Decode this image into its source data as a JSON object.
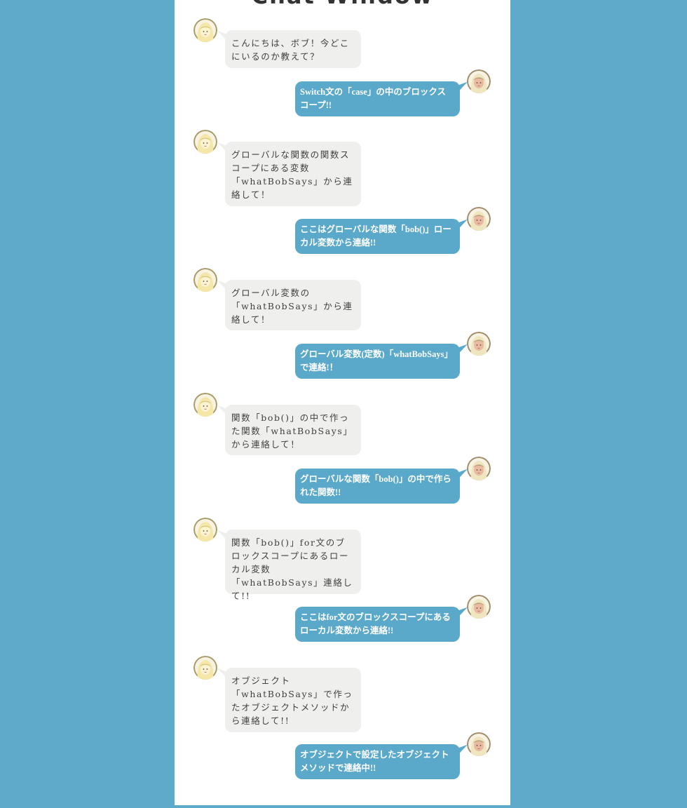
{
  "window": {
    "title": "Chat Window"
  },
  "colors": {
    "page_background": "#5eaacb",
    "left_bubble": "#eff0ee",
    "right_bubble": "#5aa9ca",
    "left_avatar_hair": "#f4e7a8",
    "right_avatar_hair": "#efe5bf"
  },
  "icons": {
    "alice_avatar": "blonde-girl-avatar-icon",
    "bob_avatar": "pink-girl-avatar-icon"
  },
  "messages": [
    {
      "side": "left",
      "text": "こんにちは、ボブ！今どこにいるのか教えて？"
    },
    {
      "side": "right",
      "text": "Switch文の「case」の中のブロックスコープ!!"
    },
    {
      "side": "left",
      "text": "グローバルな関数の関数スコープにある変数「whatBobSays」から連絡して！"
    },
    {
      "side": "right",
      "text": "ここはグローバルな関数「bob()」ローカル変数から連絡!!"
    },
    {
      "side": "left",
      "text": "グローバル変数の「whatBobSays」から連絡して！"
    },
    {
      "side": "right",
      "text": "グローバル変数(定数)「whatBobSays」で連絡!！"
    },
    {
      "side": "left",
      "text": "関数「bob()」の中で作った関数「whatBobSays」から連絡して！"
    },
    {
      "side": "right",
      "text": "グローバルな関数「bob()」の中で作られた関数!!"
    },
    {
      "side": "left",
      "text": "関数「bob()」for文のブロックスコープにあるローカル変数「whatBobSays」連絡して!!"
    },
    {
      "side": "right",
      "text": "ここはfor文のブロックスコープにあるローカル変数から連絡!!"
    },
    {
      "side": "left",
      "text": "オブジェクト「whatBobSays」で作ったオブジェクトメソッドから連絡して!!"
    },
    {
      "side": "right",
      "text": "オブジェクトで設定したオブジェクトメソッドで連絡中!!"
    }
  ]
}
